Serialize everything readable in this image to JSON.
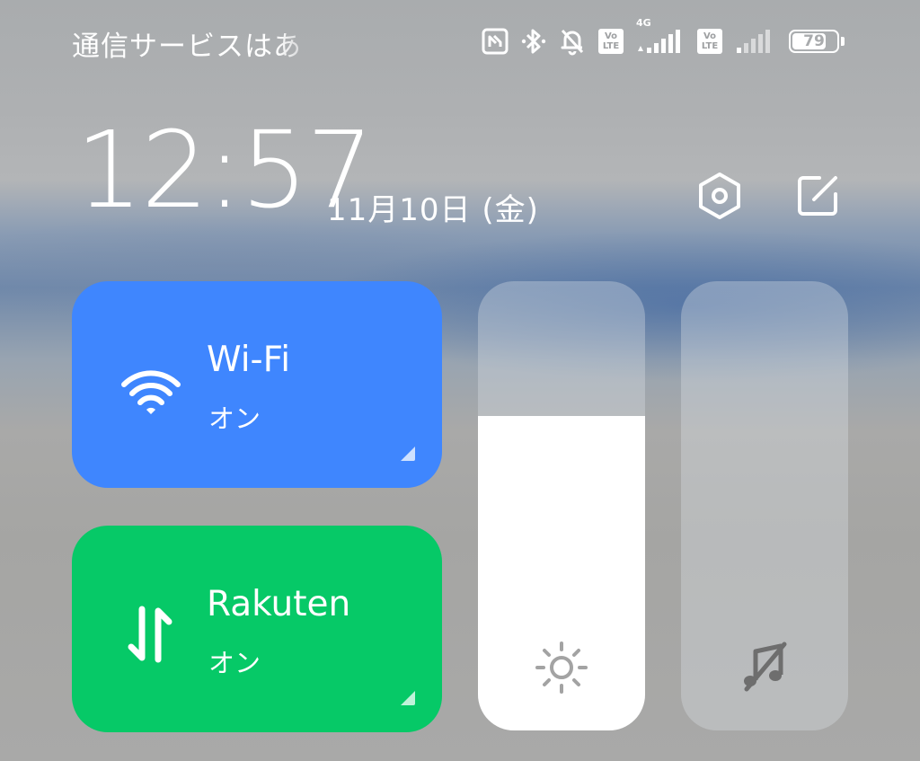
{
  "status_bar": {
    "carrier_text": "通信サービスはあ",
    "sim1_network": "4G",
    "sim1_volte": "Vo\nLTE",
    "sim2_volte": "Vo\nLTE",
    "battery_level": "79",
    "icons": [
      "nfc-icon",
      "bluetooth-icon",
      "bell-off-icon",
      "volte-icon",
      "signal-icon",
      "volte-icon",
      "signal-icon",
      "battery-icon"
    ]
  },
  "header": {
    "time": "12:57",
    "date": "11月10日 (金)",
    "settings_icon": "settings-hexagon-icon",
    "edit_icon": "edit-icon"
  },
  "tiles": {
    "wifi": {
      "title": "Wi-Fi",
      "status": "オン",
      "icon": "wifi-icon",
      "color": "#3f86fe"
    },
    "mobile_data": {
      "title": "Rakuten",
      "status": "オン",
      "icon": "mobile-data-arrows-icon",
      "color": "#06c967"
    }
  },
  "sliders": {
    "brightness": {
      "level_percent": 70,
      "icon": "sun-icon"
    },
    "volume": {
      "level_percent": 0,
      "icon": "music-muted-icon"
    }
  }
}
